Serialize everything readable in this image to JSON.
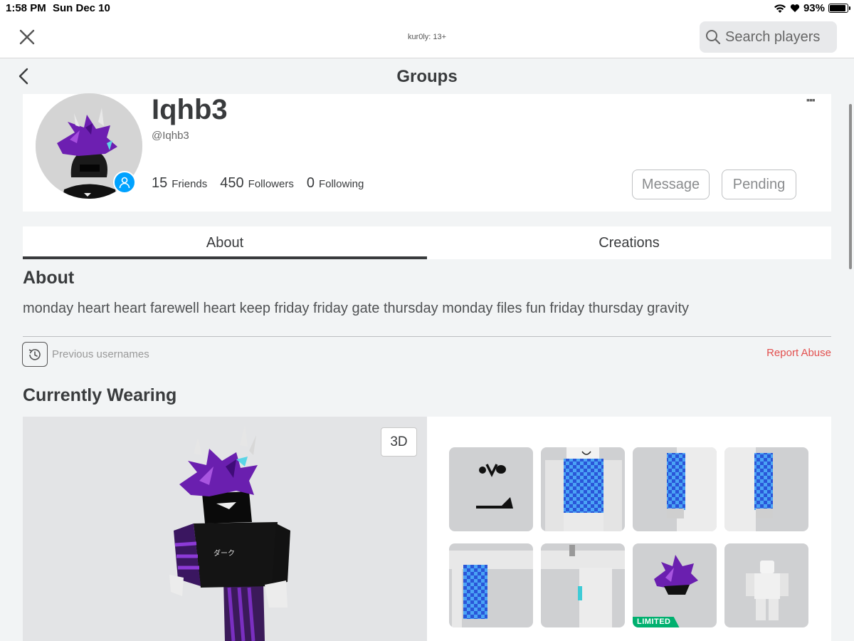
{
  "status_bar": {
    "time": "1:58 PM",
    "date": "Sun Dec 10",
    "battery": "93%",
    "battery_level": 0.93
  },
  "top_bar": {
    "title": "kur0ly: 13+",
    "search_placeholder": "Search players"
  },
  "header": {
    "title": "Groups"
  },
  "profile": {
    "display_name": "Iqhb3",
    "username": "@Iqhb3",
    "friends_count": "15",
    "friends_label": "Friends",
    "followers_count": "450",
    "followers_label": "Followers",
    "following_count": "0",
    "following_label": "Following",
    "message_label": "Message",
    "pending_label": "Pending",
    "more_label": "▪▪▪"
  },
  "tabs": [
    {
      "label": "About",
      "active": true
    },
    {
      "label": "Creations",
      "active": false
    }
  ],
  "about": {
    "title": "About",
    "text": "monday heart heart farewell heart keep friday friday gate thursday monday files fun friday thursday gravity",
    "previous_usernames_label": "Previous usernames",
    "report_label": "Report Abuse"
  },
  "wearing": {
    "title": "Currently Wearing",
    "view_mode_label": "3D",
    "items": [
      {
        "icon": "face-icon"
      },
      {
        "icon": "checkered-shirt-icon"
      },
      {
        "icon": "checkered-left-arm-icon"
      },
      {
        "icon": "checkered-right-arm-icon"
      },
      {
        "icon": "checkered-leg-icon"
      },
      {
        "icon": "arm-accessory-icon"
      },
      {
        "icon": "purple-hair-icon",
        "badge": "LIMITED"
      },
      {
        "icon": "avatar-body-icon"
      }
    ]
  },
  "colors": {
    "accent_blue": "#00a2ff",
    "report_red": "#e2504f",
    "limited_green": "#00b06f",
    "text_dark": "#393b3d"
  }
}
